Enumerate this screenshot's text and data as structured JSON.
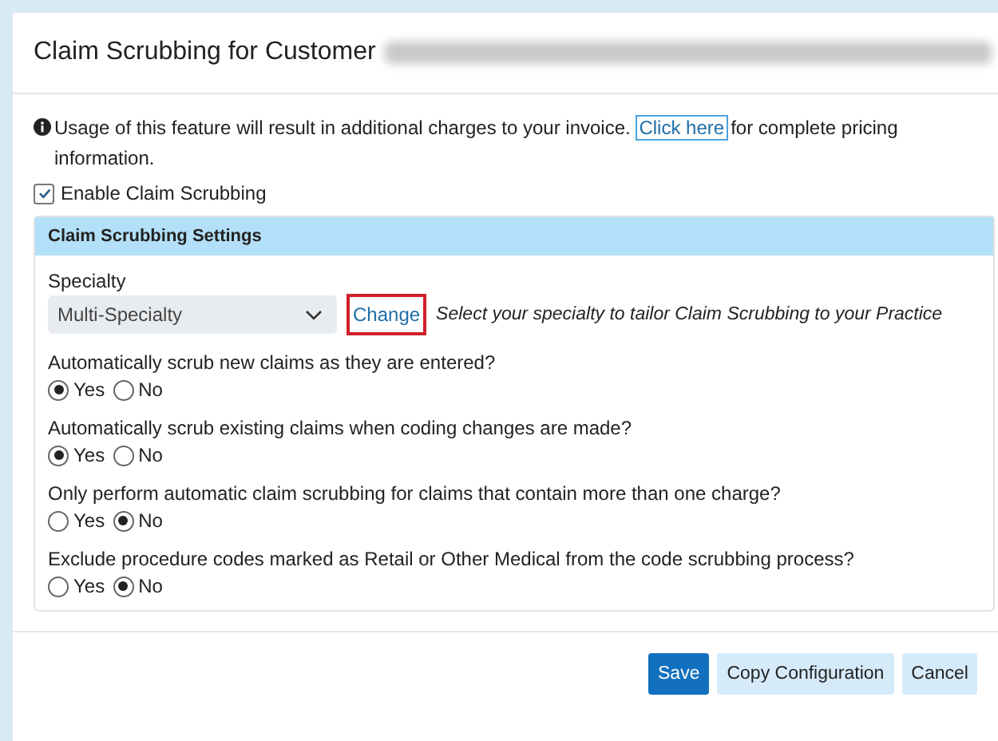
{
  "dialog": {
    "title": "Claim Scrubbing for Customer",
    "customer_redacted": true
  },
  "notice": {
    "text": "Usage of this feature will result in additional charges to your invoice.",
    "link": {
      "label": "Click here",
      "focused": true
    },
    "text_after": "for complete pricing information."
  },
  "enable": {
    "label": "Enable Claim Scrubbing",
    "checked": true
  },
  "settings": {
    "title": "Claim Scrubbing Settings",
    "specialty": {
      "label": "Specialty",
      "value": "Multi-Specialty",
      "change": {
        "label": "Change",
        "highlighted": true
      },
      "hint": "Select your specialty to tailor Claim Scrubbing to your Practice"
    },
    "questions": [
      {
        "text": "Automatically scrub new claims as they are entered?",
        "options": [
          {
            "label": "Yes",
            "selected": true
          },
          {
            "label": "No",
            "selected": false
          }
        ]
      },
      {
        "text": "Automatically scrub existing claims when coding changes are made?",
        "options": [
          {
            "label": "Yes",
            "selected": true
          },
          {
            "label": "No",
            "selected": false
          }
        ]
      },
      {
        "text": "Only perform automatic claim scrubbing for claims that contain more than one charge?",
        "options": [
          {
            "label": "Yes",
            "selected": false
          },
          {
            "label": "No",
            "selected": true
          }
        ]
      },
      {
        "text": "Exclude procedure codes marked as Retail or Other Medical from the code scrubbing process?",
        "options": [
          {
            "label": "Yes",
            "selected": false
          },
          {
            "label": "No",
            "selected": true
          }
        ]
      }
    ]
  },
  "buttons": [
    {
      "label": "Save",
      "kind": "primary"
    },
    {
      "label": "Copy Configuration",
      "kind": "secondary"
    },
    {
      "label": "Cancel",
      "kind": "secondary"
    }
  ]
}
